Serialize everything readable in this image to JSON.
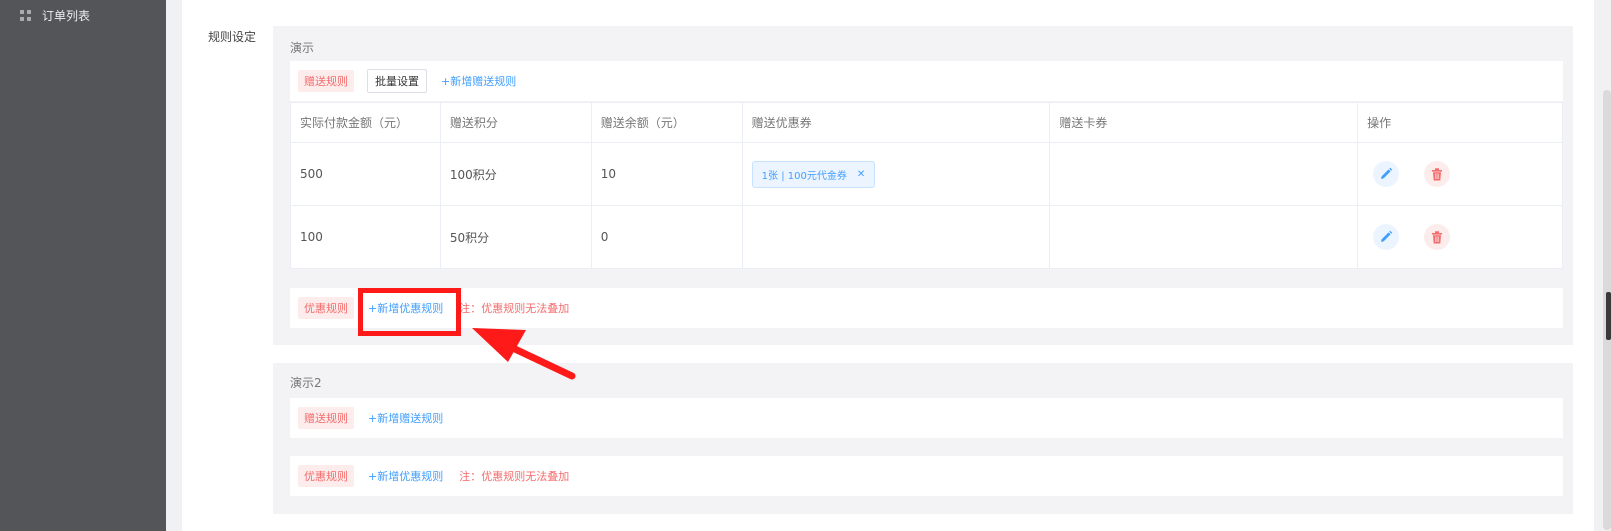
{
  "sidebar": {
    "items": [
      {
        "label": "订单列表",
        "icon": "grid-icon"
      }
    ]
  },
  "page": {
    "rule_label": "规则设定"
  },
  "groups": [
    {
      "title": "演示",
      "gift": {
        "tag": "赠送规则",
        "batch_label": "批量设置",
        "add_label": "+新增赠送规则",
        "columns": [
          "实际付款金额（元）",
          "赠送积分",
          "赠送余额（元）",
          "赠送优惠券",
          "赠送卡券",
          "操作"
        ],
        "rows": [
          {
            "amount": "500",
            "points": "100积分",
            "balance": "10",
            "coupon": "1张 | 100元代金券",
            "card": ""
          },
          {
            "amount": "100",
            "points": "50积分",
            "balance": "0",
            "coupon": "",
            "card": ""
          }
        ]
      },
      "discount": {
        "tag": "优惠规则",
        "add_label": "+新增优惠规则",
        "note": "注：优惠规则无法叠加"
      }
    },
    {
      "title": "演示2",
      "gift": {
        "tag": "赠送规则",
        "add_label": "+新增赠送规则"
      },
      "discount": {
        "tag": "优惠规则",
        "add_label": "+新增优惠规则",
        "note": "注：优惠规则无法叠加"
      }
    }
  ],
  "colors": {
    "accent_blue": "#409eff",
    "danger_red": "#f56c6c",
    "annotation_red": "#ff1a1a",
    "sidebar_bg": "#535559"
  }
}
